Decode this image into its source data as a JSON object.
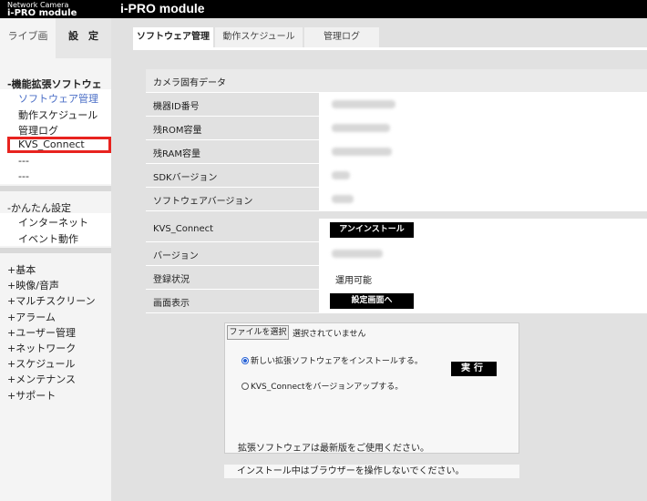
{
  "header": {
    "brand_line1": "Network Camera",
    "brand_line2": "i-PRO module",
    "title": "i-PRO module"
  },
  "sidebar": {
    "tabs": [
      "ライブ画",
      "設　定"
    ],
    "section_ext": "-機能拡張ソフトウェア",
    "ext_items": [
      "ソフトウェア管理",
      "動作スケジュール",
      "管理ログ",
      "KVS_Connect",
      "---",
      "---"
    ],
    "section_easy": "-かんたん設定",
    "easy_items": [
      "インターネット",
      "イベント動作"
    ],
    "plus_items": [
      "+基本",
      "+映像/音声",
      "+マルチスクリーン",
      "+アラーム",
      "+ユーザー管理",
      "+ネットワーク",
      "+スケジュール",
      "+メンテナンス",
      "+サポート"
    ]
  },
  "main": {
    "tabs": [
      "ソフトウェア管理",
      "動作スケジュール",
      "管理ログ"
    ],
    "camera_section": "カメラ固有データ",
    "camera_rows": [
      "機器ID番号",
      "残ROM容量",
      "残RAM容量",
      "SDKバージョン",
      "ソフトウェアバージョン"
    ],
    "kvs_rows": {
      "name_label": "KVS_Connect",
      "uninstall_label": "アンインストール",
      "version_label": "バージョン",
      "status_label": "登録状況",
      "status_value": "運用可能",
      "screen_label": "画面表示",
      "screen_button": "設定画面へ"
    },
    "install": {
      "file_button": "ファイルを選択",
      "no_file": "選択されていません",
      "radio_new": "新しい拡張ソフトウェアをインストールする。",
      "radio_update": "KVS_Connectをバージョンアップする。",
      "exec_button": "実行",
      "latest_note": "拡張ソフトウェアは最新版をご使用ください。",
      "warning": "インストール中はブラウザーを操作しないでください。"
    }
  }
}
